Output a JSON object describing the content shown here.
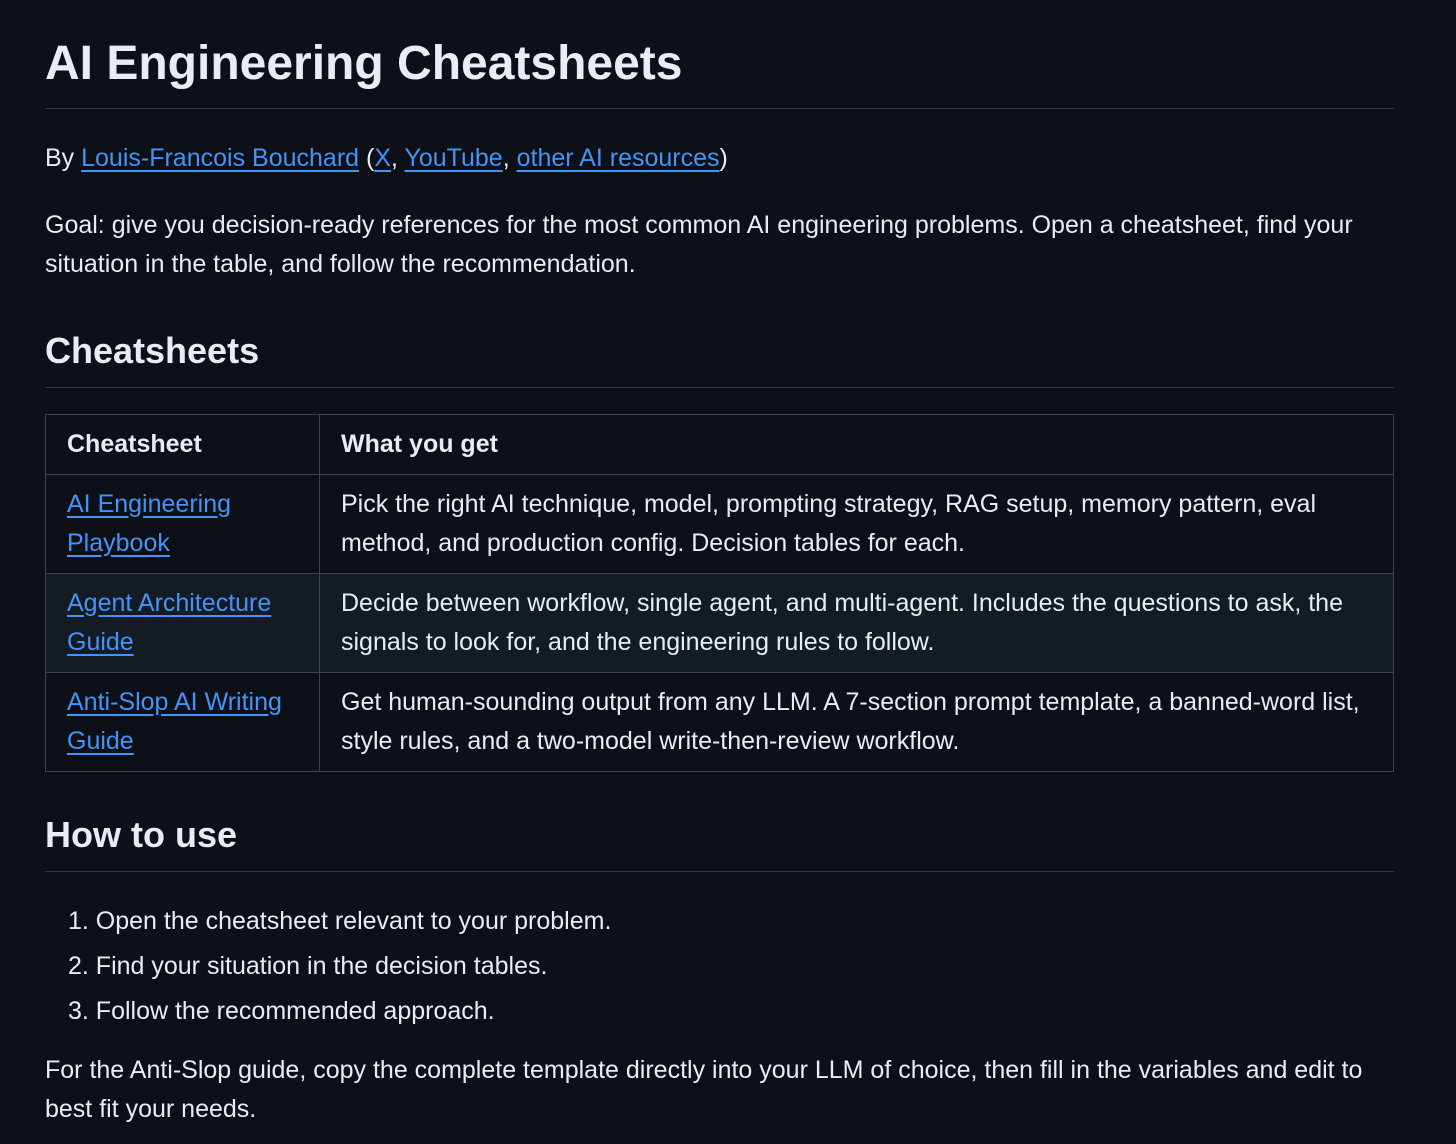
{
  "title": "AI Engineering Cheatsheets",
  "byline": {
    "prefix": "By ",
    "author": "Louis-Francois Bouchard",
    "open_paren": " (",
    "x": "X",
    "sep1": ", ",
    "youtube": "YouTube",
    "sep2": ", ",
    "resources": "other AI resources",
    "close_paren": ")"
  },
  "goal": "Goal: give you decision-ready references for the most common AI engineering problems. Open a cheatsheet, find your situation in the table, and follow the recommendation.",
  "cheatsheets_heading": "Cheatsheets",
  "table": {
    "headers": [
      "Cheatsheet",
      "What you get"
    ],
    "rows": [
      {
        "name": "AI Engineering Playbook",
        "description": "Pick the right AI technique, model, prompting strategy, RAG setup, memory pattern, eval method, and production config. Decision tables for each."
      },
      {
        "name": "Agent Architecture Guide",
        "description": "Decide between workflow, single agent, and multi-agent. Includes the questions to ask, the signals to look for, and the engineering rules to follow."
      },
      {
        "name": "Anti-Slop AI Writing Guide",
        "description": "Get human-sounding output from any LLM. A 7-section prompt template, a banned-word list, style rules, and a two-model write-then-review workflow."
      }
    ]
  },
  "howto_heading": "How to use",
  "steps": [
    "1. Open the cheatsheet relevant to your problem.",
    "2. Find your situation in the decision tables.",
    "3. Follow the recommended approach."
  ],
  "final": "For the Anti-Slop guide, copy the complete template directly into your LLM of choice, then fill in the variables and edit to best fit your needs.",
  "colors": {
    "background": "#0d1117",
    "text": "#e6edf3",
    "link": "#4493f8",
    "border": "#3d444d",
    "row_alt": "#151b23"
  }
}
